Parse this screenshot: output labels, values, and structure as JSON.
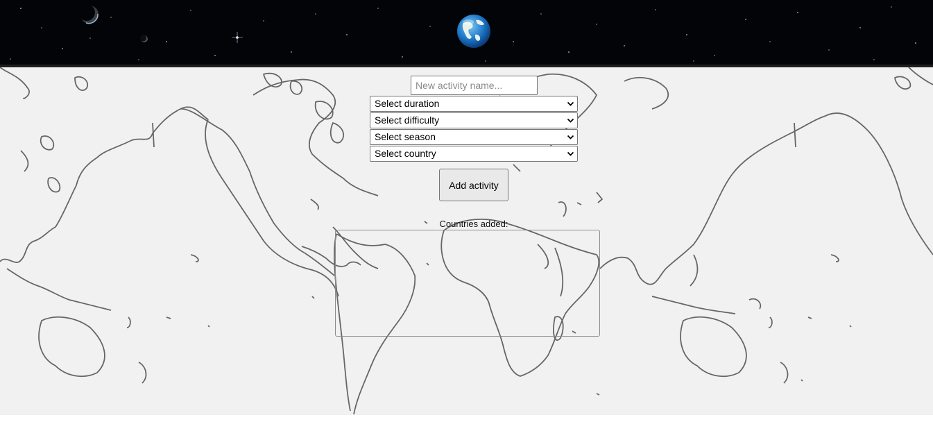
{
  "header": {
    "logo_icon": "earth-globe-icon",
    "background_theme": "starry-space",
    "colors": {
      "background": "#030407",
      "border": "#1e1e20"
    }
  },
  "form": {
    "activity_name": {
      "value": "",
      "placeholder": "New activity name..."
    },
    "duration_select": {
      "selected": "Select duration"
    },
    "difficulty_select": {
      "selected": "Select difficulty"
    },
    "season_select": {
      "selected": "Select season"
    },
    "country_select": {
      "selected": "Select country"
    },
    "add_button_label": "Add activity",
    "countries_added_label": "Countries added:"
  },
  "map": {
    "icon": "world-map-outline",
    "colors": {
      "background": "#f1f1f1",
      "outline": "#666666"
    }
  }
}
